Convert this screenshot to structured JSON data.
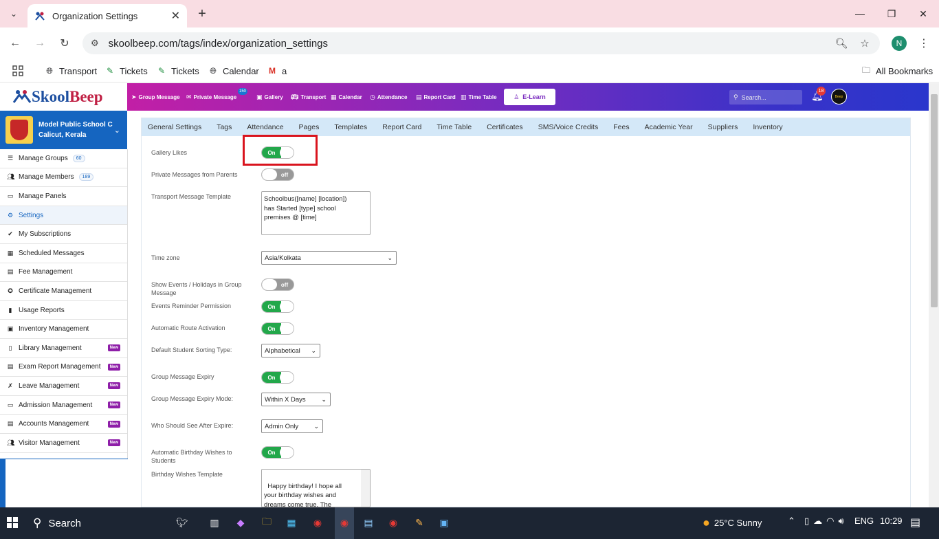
{
  "browser": {
    "tab_title": "Organization Settings",
    "url": "skoolbeep.com/tags/index/organization_settings",
    "profile_initial": "N",
    "bookmarks": [
      {
        "label": "Transport",
        "icon": "globe-icon"
      },
      {
        "label": "Tickets",
        "icon": "ticket-icon"
      },
      {
        "label": "Tickets",
        "icon": "ticket-icon"
      },
      {
        "label": "Calendar",
        "icon": "globe-icon"
      },
      {
        "label": "a",
        "icon": "gmail-icon"
      }
    ],
    "all_bookmarks": "All Bookmarks"
  },
  "app": {
    "logo_a": "Skool",
    "logo_b": "Beep",
    "header_nav": [
      {
        "label": "Group Message",
        "icon": "send-icon"
      },
      {
        "label": "Private Message",
        "icon": "envelope-icon",
        "badge": "150"
      },
      {
        "label": "Gallery",
        "icon": "image-icon"
      },
      {
        "label": "Transport",
        "icon": "bus-icon"
      },
      {
        "label": "Calendar",
        "icon": "calendar-icon"
      },
      {
        "label": "Attendance",
        "icon": "clock-icon"
      },
      {
        "label": "Report Card",
        "icon": "document-icon"
      },
      {
        "label": "Time Table",
        "icon": "timetable-icon"
      }
    ],
    "elearn": "E-Learn",
    "search_placeholder": "Search...",
    "notif_count": "18",
    "user_badge": "Beep"
  },
  "school": {
    "name": "Model Public School C",
    "location": "Calicut, Kerala"
  },
  "sidebar": [
    {
      "label": "Manage Groups",
      "icon": "list-icon",
      "count": "60"
    },
    {
      "label": "Manage Members",
      "icon": "users-icon",
      "count": "189"
    },
    {
      "label": "Manage Panels",
      "icon": "monitor-icon"
    },
    {
      "label": "Settings",
      "icon": "gear-icon",
      "active": true
    },
    {
      "label": "My Subscriptions",
      "icon": "check-icon"
    },
    {
      "label": "Scheduled Messages",
      "icon": "calendar-icon"
    },
    {
      "label": "Fee Management",
      "icon": "file-icon"
    },
    {
      "label": "Certificate Management",
      "icon": "certificate-icon"
    },
    {
      "label": "Usage Reports",
      "icon": "bar-chart-icon"
    },
    {
      "label": "Inventory Management",
      "icon": "inventory-icon"
    },
    {
      "label": "Library Management",
      "icon": "book-icon",
      "new": "New"
    },
    {
      "label": "Exam Report Management",
      "icon": "file-icon",
      "new": "New"
    },
    {
      "label": "Leave Management",
      "icon": "leave-icon",
      "new": "New"
    },
    {
      "label": "Admission Management",
      "icon": "id-card-icon",
      "new": "New"
    },
    {
      "label": "Accounts Management",
      "icon": "file-icon",
      "new": "New"
    },
    {
      "label": "Visitor Management",
      "icon": "users-icon",
      "new": "New"
    }
  ],
  "subnav": [
    "General Settings",
    "Tags",
    "Attendance",
    "Pages",
    "Templates",
    "Report Card",
    "Time Table",
    "Certificates",
    "SMS/Voice Credits",
    "Fees",
    "Academic Year",
    "Suppliers",
    "Inventory"
  ],
  "settings": {
    "gallery_likes": {
      "label": "Gallery Likes",
      "state": "On"
    },
    "private_messages": {
      "label": "Private Messages from Parents",
      "state": "off"
    },
    "transport_template": {
      "label": "Transport Message Template",
      "value": "Schoolbus([name] [location])\nhas Started [type] school\npremises @ [time]"
    },
    "time_zone": {
      "label": "Time zone",
      "value": "Asia/Kolkata"
    },
    "show_events": {
      "label": "Show Events / Holidays in Group Message",
      "state": "off"
    },
    "events_reminder": {
      "label": "Events Reminder Permission",
      "state": "On"
    },
    "auto_route": {
      "label": "Automatic Route Activation",
      "state": "On"
    },
    "sorting_type": {
      "label": "Default Student Sorting Type:",
      "value": "Alphabetical"
    },
    "gm_expiry": {
      "label": "Group Message Expiry",
      "state": "On"
    },
    "gm_expiry_mode": {
      "label": "Group Message Expiry Mode:",
      "value": "Within X Days"
    },
    "who_see": {
      "label": "Who Should See After Expire:",
      "value": "Admin Only"
    },
    "birthday_wishes": {
      "label": "Automatic Birthday Wishes to Students",
      "state": "On"
    },
    "birthday_template": {
      "label": "Birthday Wishes Template",
      "value": "Happy birthday! I hope all\nyour birthday wishes and\ndreams come true. The\nPrincipal and the Teachers"
    }
  },
  "taskbar": {
    "search": "Search",
    "weather": "25°C  Sunny",
    "lang": "ENG",
    "time": "10:29"
  }
}
